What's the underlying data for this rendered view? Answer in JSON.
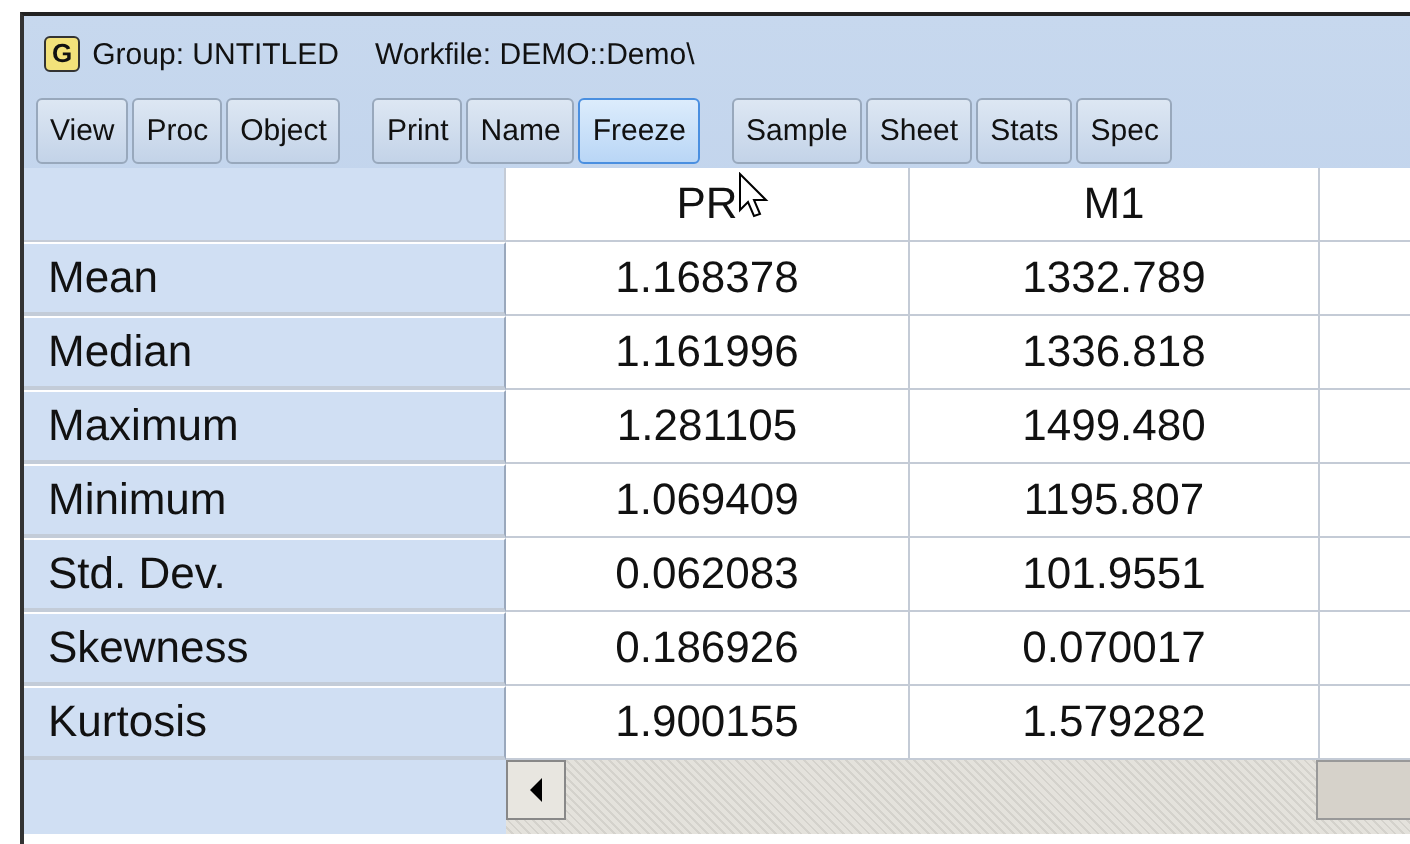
{
  "window": {
    "badge": "G",
    "title": "Group: UNTITLED",
    "workfile": "Workfile: DEMO::Demo\\"
  },
  "toolbar": [
    [
      {
        "label": "View",
        "hovered": false
      },
      {
        "label": "Proc",
        "hovered": false
      },
      {
        "label": "Object",
        "hovered": false
      }
    ],
    [
      {
        "label": "Print",
        "hovered": false
      },
      {
        "label": "Name",
        "hovered": false
      },
      {
        "label": "Freeze",
        "hovered": true
      }
    ],
    [
      {
        "label": "Sample",
        "hovered": false
      },
      {
        "label": "Sheet",
        "hovered": false
      },
      {
        "label": "Stats",
        "hovered": false
      },
      {
        "label": "Spec",
        "hovered": false
      }
    ]
  ],
  "table": {
    "columns": [
      "PR",
      "M1"
    ],
    "rows": [
      {
        "label": "Mean",
        "values": [
          "1.168378",
          "1332.789"
        ]
      },
      {
        "label": "Median",
        "values": [
          "1.161996",
          "1336.818"
        ]
      },
      {
        "label": "Maximum",
        "values": [
          "1.281105",
          "1499.480"
        ]
      },
      {
        "label": "Minimum",
        "values": [
          "1.069409",
          "1195.807"
        ]
      },
      {
        "label": "Std. Dev.",
        "values": [
          "0.062083",
          "101.9551"
        ]
      },
      {
        "label": "Skewness",
        "values": [
          "0.186926",
          "0.070017"
        ]
      },
      {
        "label": "Kurtosis",
        "values": [
          "1.900155",
          "1.579282"
        ]
      }
    ]
  }
}
